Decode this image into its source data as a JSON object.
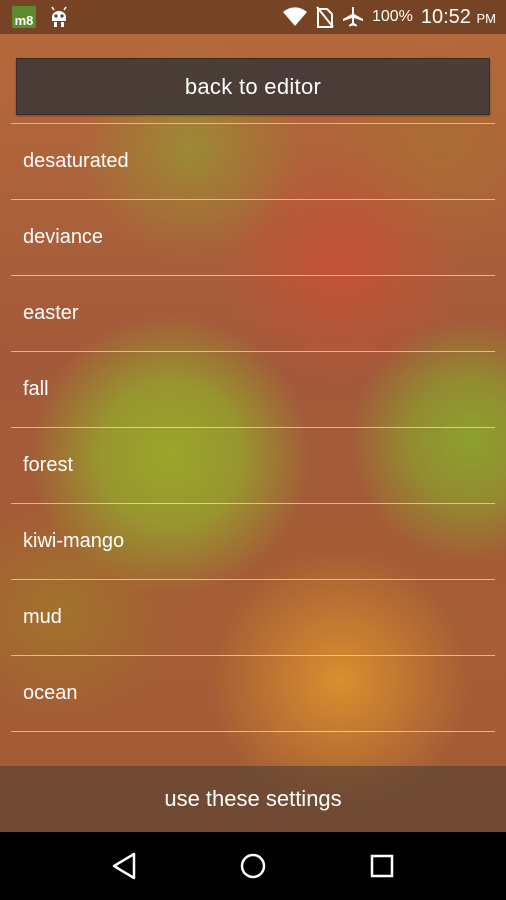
{
  "status_bar": {
    "app_badge": "m8",
    "battery": "100%",
    "time": "10:52",
    "ampm": "PM"
  },
  "header": {
    "back_label": "back to editor"
  },
  "presets": [
    {
      "label": "desaturated"
    },
    {
      "label": "deviance"
    },
    {
      "label": "easter"
    },
    {
      "label": "fall"
    },
    {
      "label": "forest"
    },
    {
      "label": "kiwi-mango"
    },
    {
      "label": "mud"
    },
    {
      "label": "ocean"
    }
  ],
  "footer": {
    "apply_label": "use these settings"
  },
  "icons": {
    "notification_android": "android-icon",
    "wifi": "wifi-icon",
    "no_sim": "no-sim-icon",
    "airplane": "airplane-icon",
    "nav_back": "back-triangle-icon",
    "nav_home": "home-circle-icon",
    "nav_recents": "recents-square-icon"
  }
}
